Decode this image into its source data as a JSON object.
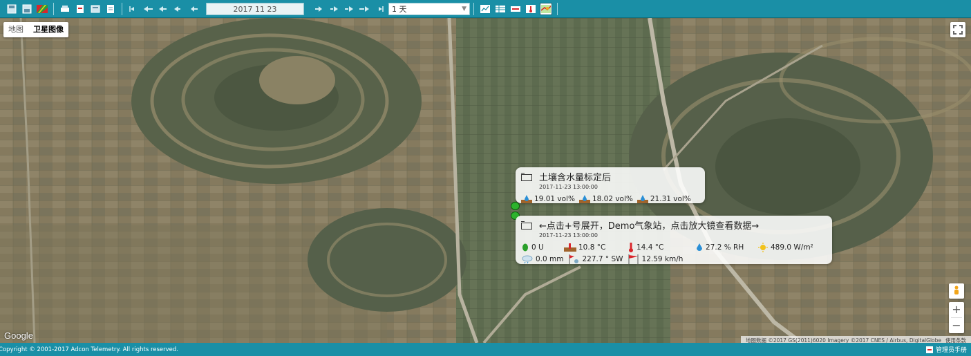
{
  "toolbar": {
    "date": "2017 11 23",
    "range": "1 天",
    "buttons": [
      "save-icon",
      "save-as-icon",
      "flag-icon",
      "print-icon",
      "pdf-icon",
      "calculator-icon",
      "document-icon",
      "first-icon",
      "back-large-icon",
      "back-medium-icon",
      "back-small-icon",
      "prev-icon",
      "next-icon",
      "forward-small-icon",
      "forward-medium-icon",
      "forward-large-icon",
      "last-icon",
      "chart-icon",
      "table-icon",
      "list-icon",
      "thermometer-icon",
      "map-icon"
    ]
  },
  "map": {
    "map_type_options": [
      "地图",
      "卫星图像"
    ],
    "active_map_type": "卫星图像",
    "google_label": "Google",
    "attribution": [
      "地图数据 ©2017 GS(2011)6020 Imagery ©2017 CNES / Airbus, DigitalGlobe",
      "使用条款"
    ],
    "zoom_in": "+",
    "zoom_out": "−"
  },
  "popups": [
    {
      "title": "土壤含水量标定后",
      "timestamp": "2017-11-23 13:00:00",
      "readings": [
        "19.01 vol%",
        "18.02 vol%",
        "21.31 vol%"
      ]
    },
    {
      "title": "←点击+号展开，Demo气象站，点击放大镜查看数据→",
      "timestamp": "2017-11-23 13:00:00",
      "row1": [
        "0 U",
        "10.8 °C",
        "14.4 °C",
        "27.2 % RH",
        "489.0 W/m²"
      ],
      "row2": [
        "0.0 mm",
        "227.7 ° SW",
        "12.59 km/h"
      ]
    }
  ],
  "footer": {
    "copyright": "Copyright © 2001-2017 Adcon Telemetry. All rights reserved.",
    "manual": "管理员手册"
  },
  "colors": {
    "brand": "#1a8fa6",
    "marker": "#2db32d"
  }
}
